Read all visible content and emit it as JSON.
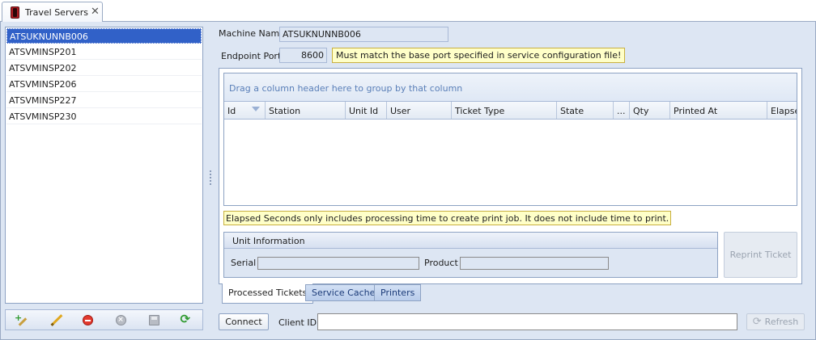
{
  "tab": {
    "title": "Travel Servers",
    "close_glyph": "✕"
  },
  "server_list": {
    "items": [
      {
        "label": "ATSUKNUNNB006",
        "selected": true
      },
      {
        "label": "ATSVMINSP201",
        "selected": false
      },
      {
        "label": "ATSVMINSP202",
        "selected": false
      },
      {
        "label": "ATSVMINSP206",
        "selected": false
      },
      {
        "label": "ATSVMINSP227",
        "selected": false
      },
      {
        "label": "ATSVMINSP230",
        "selected": false
      }
    ]
  },
  "toolbar": {
    "icons": [
      "add-server-icon",
      "edit-icon",
      "delete-icon",
      "cancel-icon",
      "save-icon",
      "refresh-icon"
    ]
  },
  "details": {
    "machine_name_label": "Machine Name",
    "machine_name_value": "ATSUKNUNNB006",
    "endpoint_port_label": "Endpoint Port",
    "endpoint_port_value": "8600",
    "port_note": "Must match the base port specified in service configuration file!"
  },
  "grid": {
    "group_hint": "Drag a column header here to group by that column",
    "columns": [
      "Id",
      "Station",
      "Unit Id",
      "User",
      "Ticket Type",
      "State",
      "...",
      "Qty",
      "Printed At",
      "Elapsed"
    ],
    "rows": []
  },
  "elapsed_note": "Elapsed Seconds only includes processing time to create print job. It does not include time to print.",
  "unit_info": {
    "header": "Unit Information",
    "serial_label": "Serial",
    "serial_value": "",
    "product_label": "Product",
    "product_value": ""
  },
  "reprint_button": "Reprint Ticket",
  "bottom_tabs": [
    {
      "label": "Processed Tickets",
      "active": true
    },
    {
      "label": "Service Cache",
      "active": false
    },
    {
      "label": "Printers",
      "active": false
    }
  ],
  "footer": {
    "connect_label": "Connect",
    "client_id_label": "Client ID",
    "client_id_value": "",
    "refresh_label": "Refresh"
  },
  "colors": {
    "selection": "#3161c8",
    "panel_bg": "#dde6f3",
    "note_bg": "#ffffc8",
    "border": "#8da2c3"
  }
}
